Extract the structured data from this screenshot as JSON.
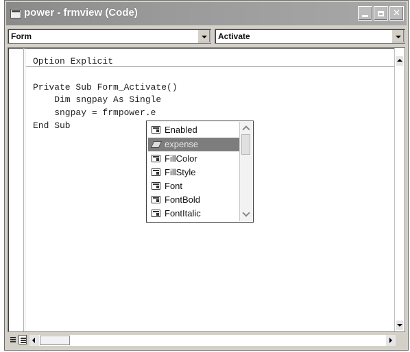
{
  "window": {
    "title": "power - frmview (Code)"
  },
  "object_combo": {
    "value": "Form"
  },
  "procedure_combo": {
    "value": "Activate"
  },
  "code_lines": [
    "Option Explicit",
    "Private Sub Form_Activate()",
    "    Dim sngpay As Single",
    "    sngpay = frmpower.e",
    "End Sub"
  ],
  "autocomplete": {
    "items": [
      {
        "label": "Enabled",
        "icon": "property-icon",
        "selected": false
      },
      {
        "label": "expense",
        "icon": "method-icon",
        "selected": true
      },
      {
        "label": "FillColor",
        "icon": "property-icon",
        "selected": false
      },
      {
        "label": "FillStyle",
        "icon": "property-icon",
        "selected": false
      },
      {
        "label": "Font",
        "icon": "property-icon",
        "selected": false
      },
      {
        "label": "FontBold",
        "icon": "property-icon",
        "selected": false
      },
      {
        "label": "FontItalic",
        "icon": "property-icon",
        "selected": false
      }
    ]
  },
  "colors": {
    "titlebar": "#9a9a9a",
    "selection": "#7d7d7d"
  }
}
